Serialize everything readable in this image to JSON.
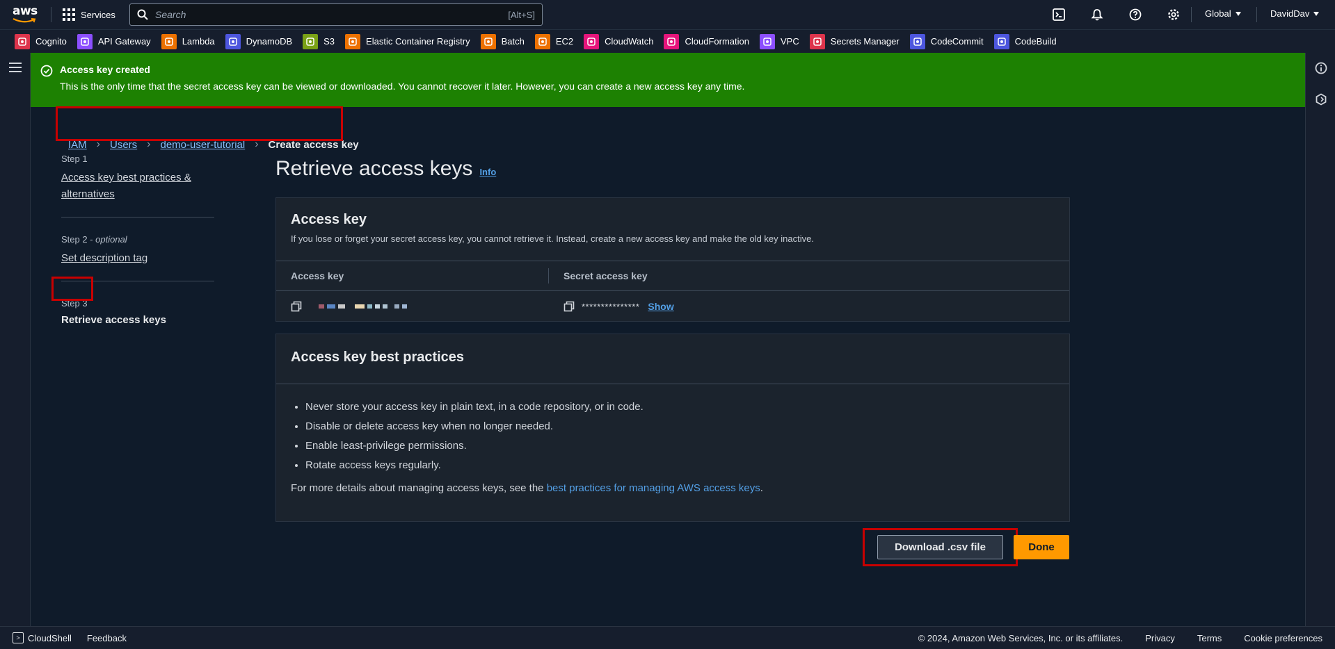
{
  "topnav": {
    "logo_text": "aws",
    "services_label": "Services",
    "search_placeholder": "Search",
    "search_shortcut": "[Alt+S]",
    "region": "Global",
    "account": "DavidDav"
  },
  "favorites": [
    {
      "label": "Cognito",
      "color": "#dd344c",
      "icon": "cognito-icon"
    },
    {
      "label": "API Gateway",
      "color": "#8c4fff",
      "icon": "api-gateway-icon"
    },
    {
      "label": "Lambda",
      "color": "#ed7100",
      "icon": "lambda-icon"
    },
    {
      "label": "DynamoDB",
      "color": "#4d56de",
      "icon": "dynamodb-icon"
    },
    {
      "label": "S3",
      "color": "#7aa116",
      "icon": "s3-icon"
    },
    {
      "label": "Elastic Container Registry",
      "color": "#ed7100",
      "icon": "ecr-icon"
    },
    {
      "label": "Batch",
      "color": "#ed7100",
      "icon": "batch-icon"
    },
    {
      "label": "EC2",
      "color": "#ed7100",
      "icon": "ec2-icon"
    },
    {
      "label": "CloudWatch",
      "color": "#e7157b",
      "icon": "cloudwatch-icon"
    },
    {
      "label": "CloudFormation",
      "color": "#e7157b",
      "icon": "cloudformation-icon"
    },
    {
      "label": "VPC",
      "color": "#8c4fff",
      "icon": "vpc-icon"
    },
    {
      "label": "Secrets Manager",
      "color": "#dd344c",
      "icon": "secrets-manager-icon"
    },
    {
      "label": "CodeCommit",
      "color": "#4d56de",
      "icon": "codecommit-icon"
    },
    {
      "label": "CodeBuild",
      "color": "#4d56de",
      "icon": "codebuild-icon"
    }
  ],
  "flash": {
    "title": "Access key created",
    "message": "This is the only time that the secret access key can be viewed or downloaded. You cannot recover it later. However, you can create a new access key any time."
  },
  "breadcrumb": {
    "items": [
      "IAM",
      "Users",
      "demo-user-tutorial"
    ],
    "current": "Create access key"
  },
  "steps": {
    "step1_label": "Step 1",
    "step1_link": "Access key best practices & alternatives",
    "step2_label": "Step 2",
    "step2_optional": "optional",
    "step2_link": "Set description tag",
    "step3_label": "Step 3",
    "step3_current": "Retrieve access keys"
  },
  "main": {
    "title": "Retrieve access keys",
    "info": "Info"
  },
  "access_key_card": {
    "title": "Access key",
    "subtitle": "If you lose or forget your secret access key, you cannot retrieve it. Instead, create a new access key and make the old key inactive.",
    "col_access_key": "Access key",
    "col_secret": "Secret access key",
    "secret_masked": "***************",
    "show_label": "Show"
  },
  "best_practices": {
    "title": "Access key best practices",
    "items": [
      "Never store your access key in plain text, in a code repository, or in code.",
      "Disable or delete access key when no longer needed.",
      "Enable least-privilege permissions.",
      "Rotate access keys regularly."
    ],
    "more_prefix": "For more details about managing access keys, see the ",
    "more_link": "best practices for managing AWS access keys",
    "more_suffix": "."
  },
  "actions": {
    "download": "Download .csv file",
    "done": "Done"
  },
  "footer": {
    "cloudshell": "CloudShell",
    "feedback": "Feedback",
    "copyright": "© 2024, Amazon Web Services, Inc. or its affiliates.",
    "privacy": "Privacy",
    "terms": "Terms",
    "cookies": "Cookie preferences"
  }
}
